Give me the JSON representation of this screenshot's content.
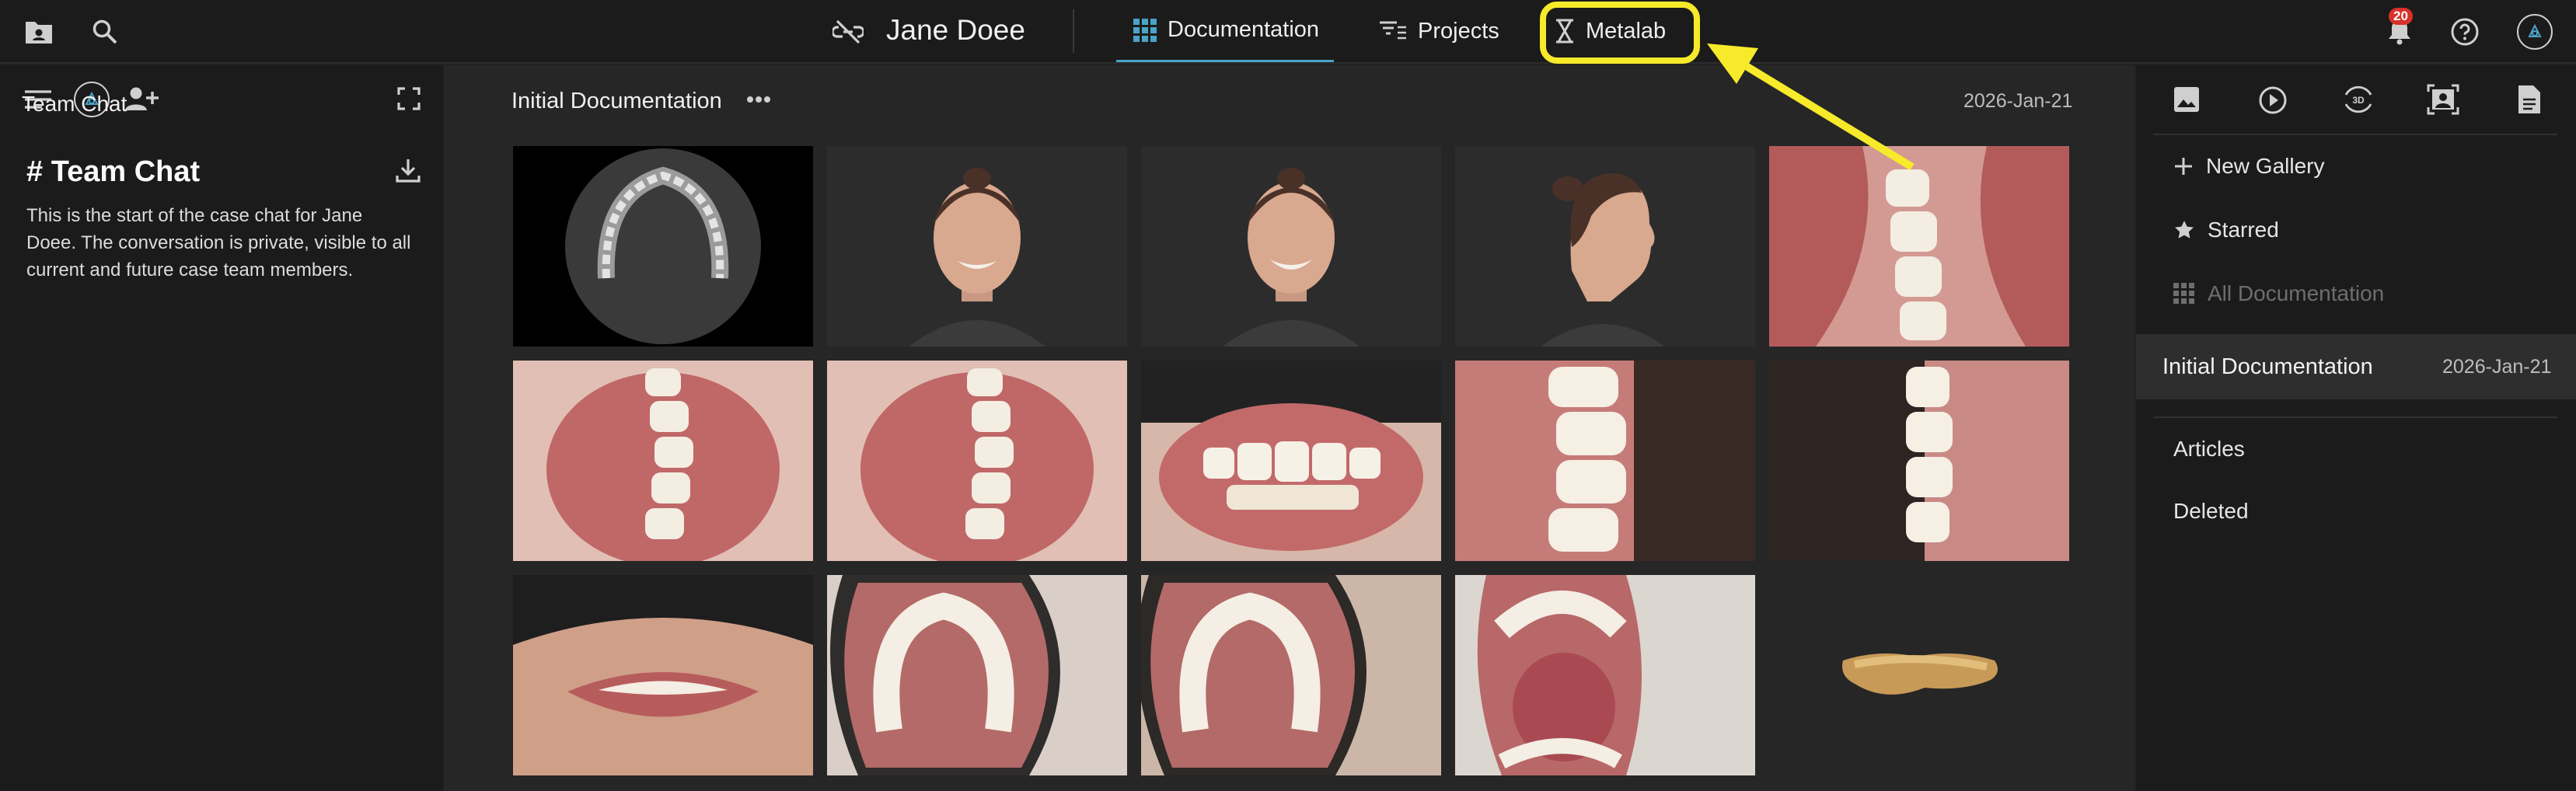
{
  "topbar": {
    "patient_name": "Jane Doee",
    "tabs": [
      {
        "label": "Documentation",
        "icon": "grid-icon",
        "active": true
      },
      {
        "label": "Projects",
        "icon": "filter-list-icon",
        "active": false
      },
      {
        "label": "Metalab",
        "icon": "hourglass-icon",
        "active": false,
        "highlighted": true
      }
    ],
    "notifications_count": "20",
    "highlight_color": "#f7ea2a",
    "accent_color": "#4aa3c8"
  },
  "left_panel": {
    "title": "Team Chat",
    "chat_heading": "# Team Chat",
    "chat_intro": "This is the start of the case chat for Jane Doee. The conversation is private, visible to all current and future case team members."
  },
  "gallery": {
    "title": "Initial Documentation",
    "date": "2026-Jan-21",
    "photos": [
      {
        "label": "CT axial scan of upper jaw"
      },
      {
        "label": "Frontal face smile"
      },
      {
        "label": "Frontal face smile close"
      },
      {
        "label": "Profile face smile"
      },
      {
        "label": "Intraoral lateral right"
      },
      {
        "label": "Intraoral lower occlusal"
      },
      {
        "label": "Intraoral lower occlusal 2"
      },
      {
        "label": "Intraoral frontal retracted"
      },
      {
        "label": "Intraoral lateral close"
      },
      {
        "label": "Intraoral lateral left"
      },
      {
        "label": "Face from below"
      },
      {
        "label": "Upper occlusal mirror"
      },
      {
        "label": "Upper occlusal mirror 2"
      },
      {
        "label": "Open mouth tongue"
      },
      {
        "label": "3D scan model"
      }
    ]
  },
  "right_panel": {
    "new_gallery": "New Gallery",
    "starred": "Starred",
    "all_documentation": "All Documentation",
    "selected_gallery": {
      "name": "Initial Documentation",
      "date": "2026-Jan-21"
    },
    "articles": "Articles",
    "deleted": "Deleted"
  }
}
